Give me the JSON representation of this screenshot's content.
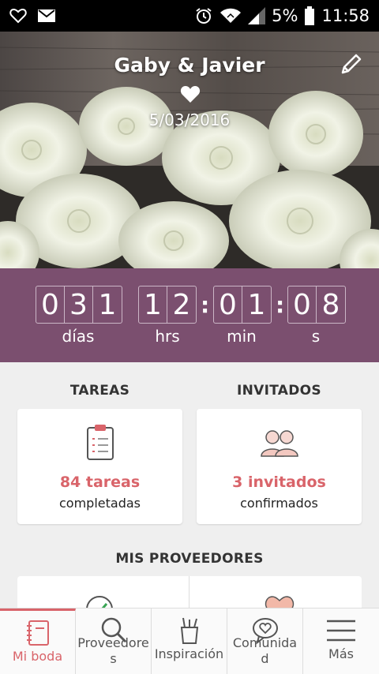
{
  "status_bar": {
    "battery": "5%",
    "time": "11:58"
  },
  "hero": {
    "couple": "Gaby & Javier",
    "date": "5/03/2016"
  },
  "countdown": {
    "days": [
      "0",
      "3",
      "1"
    ],
    "hours": [
      "1",
      "2"
    ],
    "minutes": [
      "0",
      "1"
    ],
    "seconds": [
      "0",
      "8"
    ],
    "separator": ":",
    "labels": {
      "days": "días",
      "hours": "hrs",
      "minutes": "min",
      "seconds": "s"
    }
  },
  "tasks": {
    "title": "TAREAS",
    "value": "84 tareas",
    "sub": "completadas"
  },
  "guests": {
    "title": "INVITADOS",
    "value": "3 invitados",
    "sub": "confirmados"
  },
  "providers": {
    "title": "MIS PROVEEDORES"
  },
  "nav": [
    {
      "label": "Mi boda",
      "icon": "notebook-icon"
    },
    {
      "label": "Proveedore\ns",
      "icon": "search-icon"
    },
    {
      "label": "Inspiración",
      "icon": "brush-cup-icon"
    },
    {
      "label": "Comunida\nd",
      "icon": "heart-bubble-icon"
    },
    {
      "label": "Más",
      "icon": "menu-icon"
    }
  ],
  "colors": {
    "accent": "#d9646a",
    "countdown_bg": "#7b4f6f"
  }
}
